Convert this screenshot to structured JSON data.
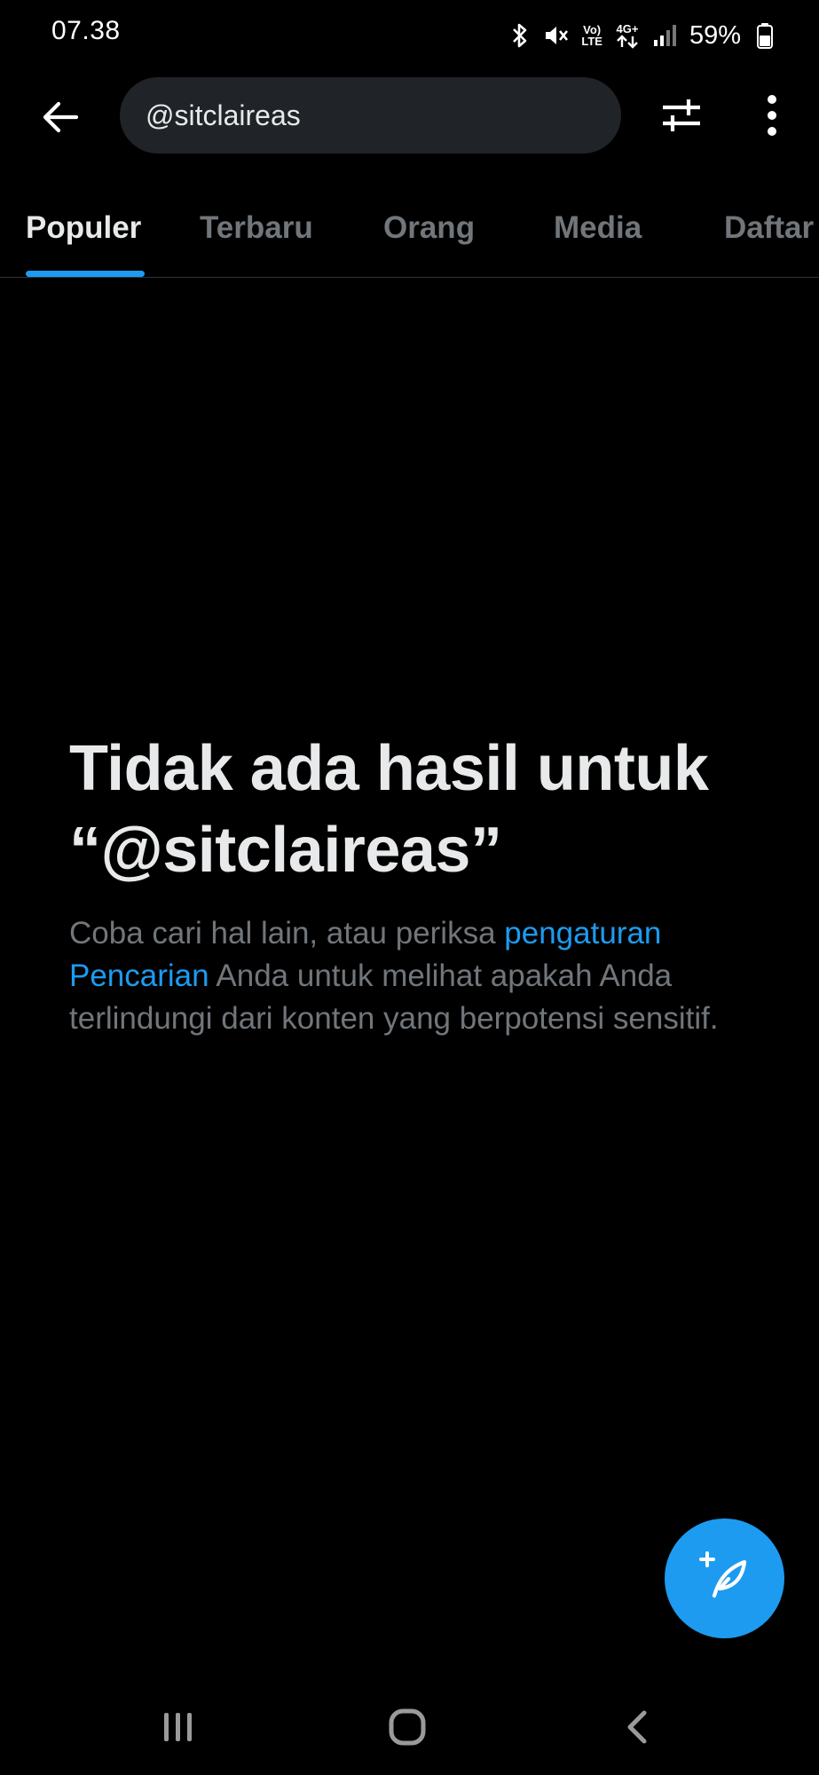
{
  "status_bar": {
    "time": "07.38",
    "battery": "59%",
    "network_top": "Vo)",
    "network_bottom": "LTE",
    "cell_top": "4G+",
    "icons": [
      "bluetooth-icon",
      "mute-icon",
      "volte-icon",
      "4g-data-icon",
      "signal-icon",
      "battery-icon"
    ]
  },
  "top_bar": {
    "search": {
      "value": "@sitclaireas"
    },
    "icons": [
      "back-arrow-icon",
      "filter-sliders-icon",
      "more-vertical-icon"
    ]
  },
  "tabs": [
    {
      "label": "Populer",
      "active": true
    },
    {
      "label": "Terbaru",
      "active": false
    },
    {
      "label": "Orang",
      "active": false
    },
    {
      "label": "Media",
      "active": false
    },
    {
      "label": "Daftar",
      "active": false
    }
  ],
  "empty_state": {
    "title_line1": "Tidak ada hasil untuk",
    "title_line2": "“@sitclaireas”",
    "desc_before": "Coba cari hal lain, atau periksa ",
    "desc_link": "pengaturan Pencarian",
    "desc_after": " Anda untuk melihat apakah Anda terlindungi dari konten yang berpotensi sensitif."
  },
  "fab": {
    "icon": "compose-feather-plus-icon"
  },
  "nav_bar": {
    "icons": [
      "recent-apps-icon",
      "home-icon",
      "back-icon"
    ]
  },
  "colors": {
    "background": "#000000",
    "primary_text": "#e7e9ea",
    "secondary_text": "#71767b",
    "accent": "#1d9bf0",
    "search_bg": "#202327",
    "divider": "#2f3336"
  }
}
